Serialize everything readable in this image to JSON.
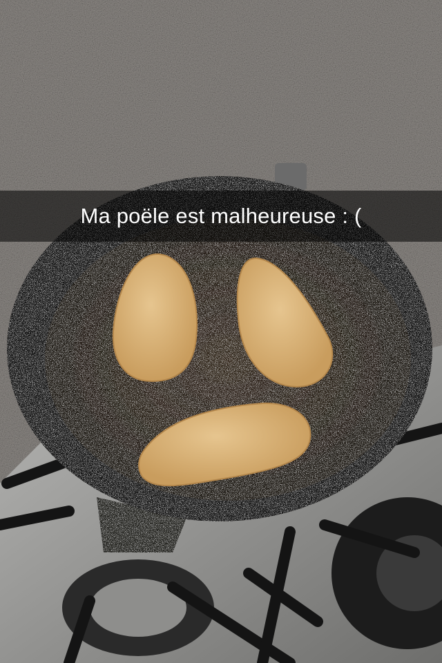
{
  "caption": {
    "text": "Ma poële est malheureuse : ("
  },
  "photo": {
    "subject": "frying-pan-with-cutlets",
    "colors": {
      "countertop": "#8a8682",
      "pan": "#1f1d1c",
      "cutlet": "#d8b47a",
      "stove": "#9a9a9a"
    }
  }
}
